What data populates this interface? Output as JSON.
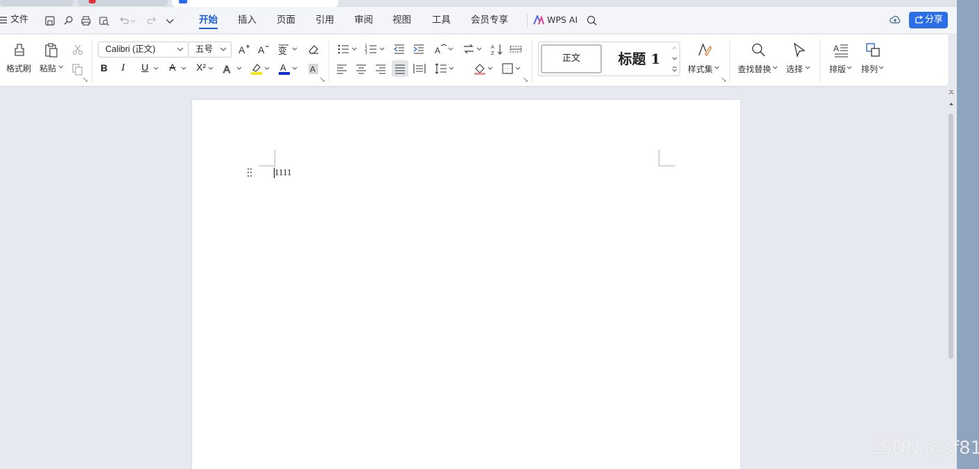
{
  "menubar": {
    "file_label": "文件",
    "tabs": [
      "开始",
      "插入",
      "页面",
      "引用",
      "审阅",
      "视图",
      "工具",
      "会员专享"
    ],
    "active_tab": "开始",
    "wps_ai_label": "WPS AI",
    "share_label": "分享"
  },
  "ribbon": {
    "format_painter_label": "格式刷",
    "paste_label": "粘贴",
    "font_name": "Calibri (正文)",
    "font_size": "五号",
    "styles": {
      "normal": "正文",
      "heading1": "标题 1"
    },
    "style_set_label": "样式集",
    "find_replace_label": "查找替换",
    "select_label": "选择",
    "layout_label": "排版",
    "arrange_label": "排列"
  },
  "document": {
    "text": "1111"
  },
  "watermark": "CSDN @sf81",
  "colors": {
    "accent": "#1a5fd6",
    "share_button": "#2b6ee8",
    "highlight": "#f5e61a",
    "font_color": "#0b2fd6"
  }
}
